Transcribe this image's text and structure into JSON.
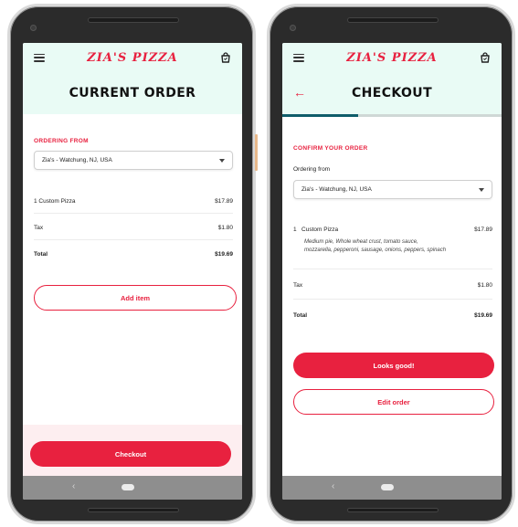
{
  "brand": "ZIA'S PIZZA",
  "screen1": {
    "title": "CURRENT ORDER",
    "section_label": "ORDERING FROM",
    "location": "Zia's - Watchung, NJ, USA",
    "item": {
      "label": "1  Custom Pizza",
      "price": "$17.89"
    },
    "tax": {
      "label": "Tax",
      "value": "$1.80"
    },
    "total": {
      "label": "Total",
      "value": "$19.69"
    },
    "add_item": "Add item",
    "checkout": "Checkout"
  },
  "screen2": {
    "title": "CHECKOUT",
    "section_label": "CONFIRM YOUR ORDER",
    "ordering_from_label": "Ordering from",
    "location": "Zia's - Watchung, NJ, USA",
    "item": {
      "qty": "1",
      "name": "Custom Pizza",
      "price": "$17.89",
      "desc_line1": "Medium pie, Whole wheat crust, tomato sauce,",
      "desc_line2": "mozzarella, pepperoni, sausage, onions, peppers, spinach"
    },
    "tax": {
      "label": "Tax",
      "value": "$1.80"
    },
    "total": {
      "label": "Total",
      "value": "$19.69"
    },
    "looks_good": "Looks good!",
    "edit_order": "Edit order"
  },
  "icons": [
    "hamburger-menu-icon",
    "shopping-bag-icon",
    "back-arrow-icon",
    "dropdown-caret-icon",
    "nav-back-icon",
    "nav-home-icon"
  ]
}
